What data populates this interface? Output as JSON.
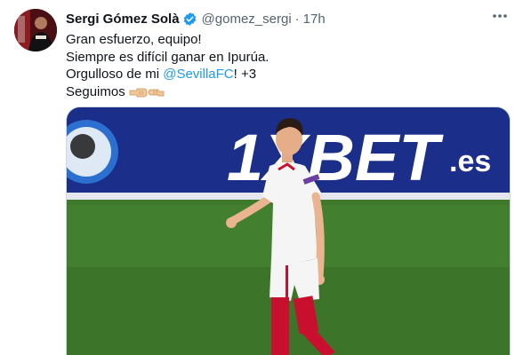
{
  "tweet": {
    "author_name": "Sergi Gómez Solà",
    "handle": "@gomez_sergi",
    "separator": "·",
    "time": "17h",
    "lines": {
      "l1": "Gran esfuerzo, equipo!",
      "l2": "Siempre es difícil ganar en Ipurúa.",
      "l3_before": "Orgulloso de mi ",
      "l3_mention": "@SevillaFC",
      "l3_after": "! +3",
      "l4": "Seguimos"
    },
    "icons": {
      "verified": "verified-badge-icon",
      "more": "more-horizontal-icon",
      "emoji": "fist-bump-emoji"
    },
    "image": {
      "board_text": "1XBET",
      "board_suffix": ".es"
    }
  },
  "colors": {
    "link": "#1d9bf0",
    "secondary_text": "#536471",
    "pitch_green": "#3f7a2c",
    "board_blue": "#1a2e8a"
  }
}
